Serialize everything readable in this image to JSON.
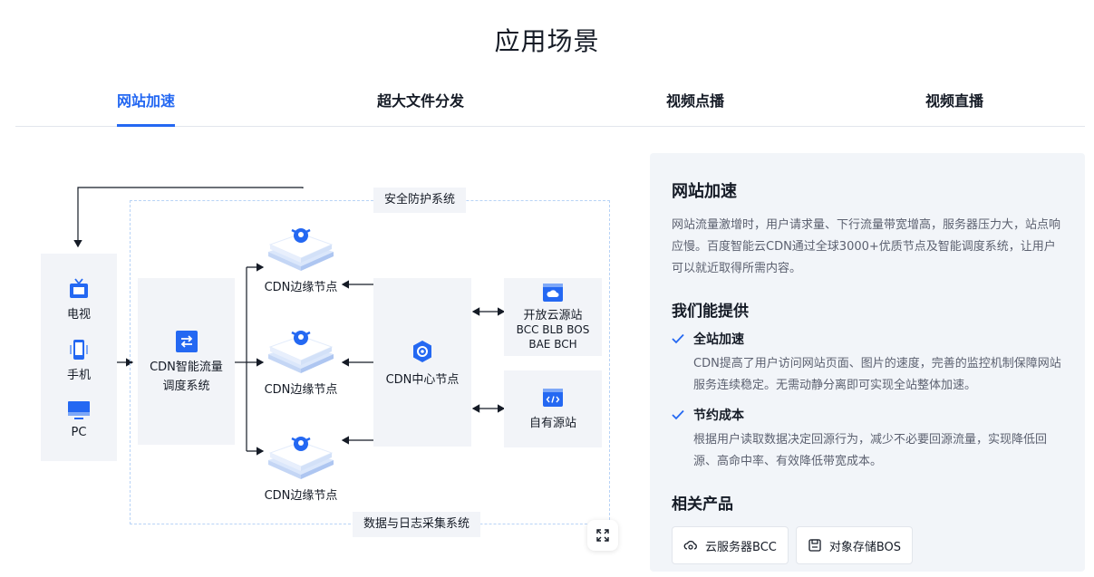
{
  "title": "应用场景",
  "tabs": [
    {
      "label": "网站加速",
      "active": true
    },
    {
      "label": "超大文件分发",
      "active": false
    },
    {
      "label": "视频点播",
      "active": false
    },
    {
      "label": "视频直播",
      "active": false
    }
  ],
  "diagram": {
    "security_label": "安全防护系统",
    "logging_label": "数据与日志采集系统",
    "devices": [
      {
        "label": "电视",
        "icon": "tv-icon"
      },
      {
        "label": "手机",
        "icon": "phone-icon"
      },
      {
        "label": "PC",
        "icon": "monitor-icon"
      }
    ],
    "scheduler": {
      "line1": "CDN智能流量",
      "line2": "调度系统"
    },
    "edge_nodes": [
      "CDN边缘节点",
      "CDN边缘节点",
      "CDN边缘节点"
    ],
    "center_node": "CDN中心节点",
    "open_origin": {
      "title": "开放云源站",
      "line1": "BCC BLB BOS",
      "line2": "BAE BCH"
    },
    "own_origin": "自有源站"
  },
  "panel": {
    "title": "网站加速",
    "description": "网站流量激增时，用户请求量、下行流量带宽增高，服务器压力大，站点响应慢。百度智能云CDN通过全球3000+优质节点及智能调度系统，让用户可以就近取得所需内容。",
    "offer_heading": "我们能提供",
    "features": [
      {
        "title": "全站加速",
        "desc": "CDN提高了用户访问网站页面、图片的速度，完善的监控机制保障网站服务连续稳定。无需动静分离即可实现全站整体加速。"
      },
      {
        "title": "节约成本",
        "desc": "根据用户读取数据决定回源行为，减少不必要回源流量，实现降低回源、高命中率、有效降低带宽成本。"
      }
    ],
    "products_heading": "相关产品",
    "products": [
      {
        "label": "云服务器BCC",
        "icon": "cloud-server-icon"
      },
      {
        "label": "对象存储BOS",
        "icon": "storage-icon"
      }
    ]
  },
  "colors": {
    "accent": "#2468f2",
    "panel_bg": "#f2f5f9",
    "box_bg": "#f2f4f8",
    "dashed": "#b8d3f6"
  }
}
